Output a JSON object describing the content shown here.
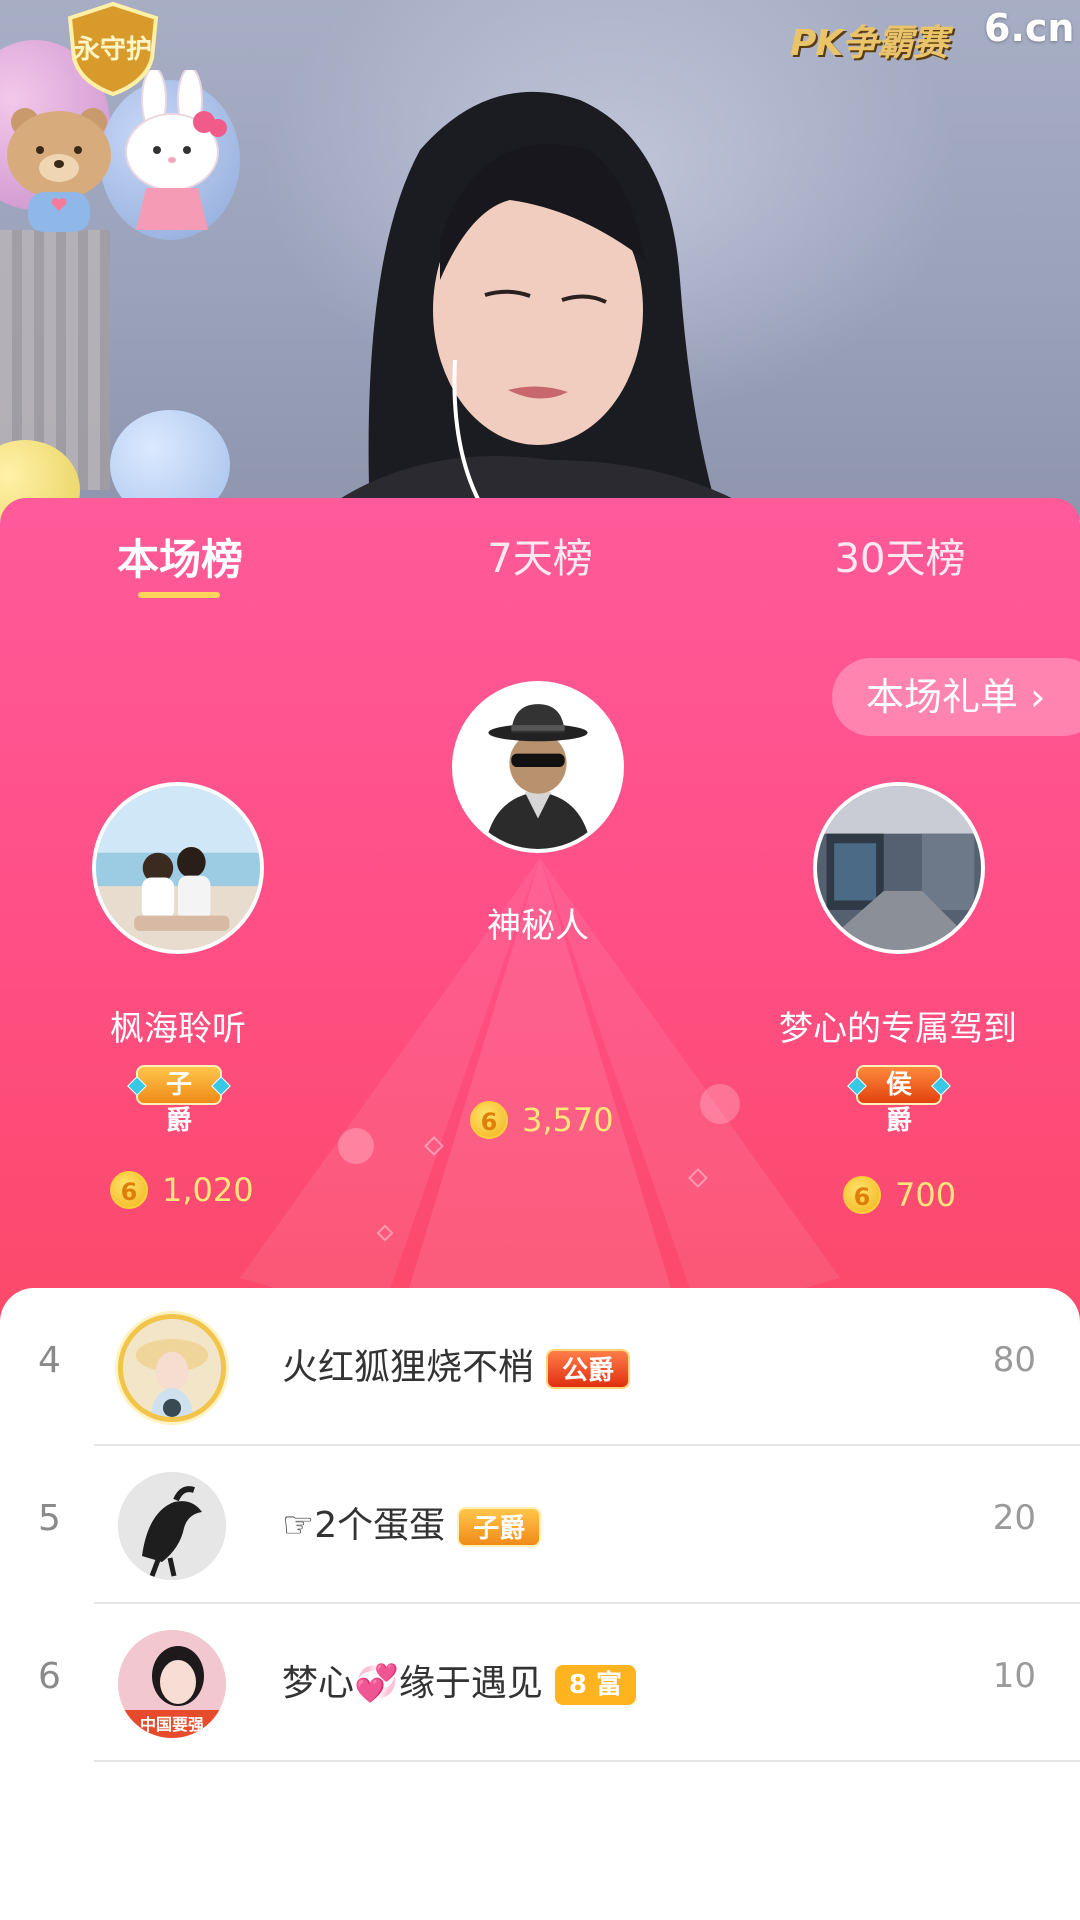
{
  "overlay": {
    "guard_badge_text": "永守护",
    "pk_logo": "PK争霸赛",
    "site_logo": "6.cn"
  },
  "tabs": [
    {
      "label": "本场榜",
      "active": true
    },
    {
      "label": "7天榜",
      "active": false
    },
    {
      "label": "30天榜",
      "active": false
    }
  ],
  "gift_list_button": "本场礼单 ›",
  "podium": {
    "first": {
      "rank": "1",
      "name": "神秘人",
      "score": "3,570",
      "avatar_icon": "mysterious-person-icon"
    },
    "second": {
      "rank": "2",
      "name": "枫海聆听",
      "title": "子爵",
      "score": "1,020"
    },
    "third": {
      "rank": "3",
      "name": "梦心的专属驾到",
      "title": "侯爵",
      "score": "700"
    }
  },
  "coin_glyph": "6",
  "list": [
    {
      "rank": "4",
      "name": "火红狐狸烧不梢",
      "badge": "公爵",
      "score": "80"
    },
    {
      "rank": "5",
      "name": "☞2个蛋蛋",
      "badge": "子爵",
      "score": "20"
    },
    {
      "rank": "6",
      "name": "梦心💞缘于遇见",
      "badge": "8 富",
      "score": "10",
      "avatar_text": "中国要强"
    }
  ],
  "colors": {
    "panel_top": "#ff5a9a",
    "panel_bottom": "#ef4250",
    "tab_underline": "#ffd45c",
    "score_gold": "#ffe67a"
  }
}
